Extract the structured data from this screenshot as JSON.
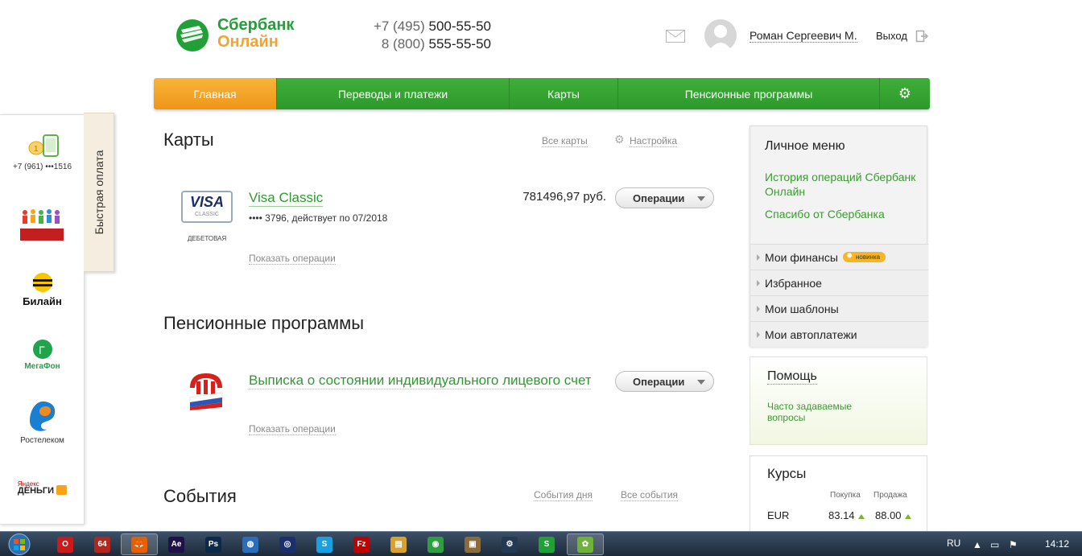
{
  "header": {
    "logo_line1": "Сбербанк",
    "logo_line2": "Онлайн",
    "phone1_prefix": "+7 (495)",
    "phone1_number": "500-55-50",
    "phone2_prefix": "8 (800)",
    "phone2_number": "555-55-50",
    "user_name": "Роман Сергеевич М.",
    "logout_label": "Выход"
  },
  "nav": {
    "items": [
      {
        "label": "Главная",
        "active": true
      },
      {
        "label": "Переводы и платежи"
      },
      {
        "label": "Карты"
      },
      {
        "label": "Пенсионные программы"
      }
    ],
    "settings_icon": "gear-icon"
  },
  "quick_pay": {
    "tab_label": "Быстрая оплата",
    "phone": "+7 (961) •••1516",
    "beeline": "Билайн",
    "megafon": "МегаФон",
    "rostelecom": "Ростелеком",
    "yandex_small": "Яндекс",
    "yandex_big": "ДЕНЬГИ"
  },
  "cards_section": {
    "title": "Карты",
    "all_cards": "Все карты",
    "settings": "Настройка",
    "card": {
      "logo_text": "VISA",
      "logo_sub": "CLASSIC",
      "type": "ДЕБЕТОВАЯ",
      "name": "Visa Classic",
      "details": "•••• 3796, действует по 07/2018",
      "amount": "781496,97 руб.",
      "ops_label": "Операции",
      "show_ops": "Показать операции"
    }
  },
  "pension_section": {
    "title": "Пенсионные программы",
    "item_name": "Выписка о состоянии индивидуального лицевого счета",
    "ops_label": "Операции",
    "show_ops": "Показать операции"
  },
  "events_section": {
    "title": "События",
    "day_events": "События дня",
    "all_events": "Все события"
  },
  "personal_menu": {
    "title": "Личное меню",
    "link1": "История операций Сбербанк Онлайн",
    "link2": "Спасибо от Сбербанка",
    "rows": [
      {
        "label": "Мои финансы",
        "badge": "новинка"
      },
      {
        "label": "Избранное"
      },
      {
        "label": "Мои шаблоны"
      },
      {
        "label": "Мои автоплатежи"
      }
    ]
  },
  "help": {
    "title": "Помощь",
    "faq": "Часто задаваемые вопросы"
  },
  "rates": {
    "title": "Курсы",
    "buy_label": "Покупка",
    "sell_label": "Продажа",
    "rows": [
      {
        "currency": "EUR",
        "buy": "83.14",
        "sell": "88.00"
      }
    ]
  },
  "taskbar": {
    "lang": "RU",
    "time": "14:12",
    "apps": [
      {
        "name": "opera",
        "color": "#cc1a1a",
        "glyph": "O"
      },
      {
        "name": "app-64",
        "color": "#b3261e",
        "glyph": "64"
      },
      {
        "name": "firefox",
        "color": "#e66000",
        "glyph": "🦊"
      },
      {
        "name": "after-effects",
        "color": "#1f1048",
        "glyph": "Ae"
      },
      {
        "name": "photoshop",
        "color": "#0b2a4a",
        "glyph": "Ps"
      },
      {
        "name": "globe",
        "color": "#2a6ebb",
        "glyph": "◍"
      },
      {
        "name": "cinema",
        "color": "#1b2f6a",
        "glyph": "◎"
      },
      {
        "name": "skype",
        "color": "#1aa0e0",
        "glyph": "S"
      },
      {
        "name": "filezilla",
        "color": "#bf0000",
        "glyph": "Fz"
      },
      {
        "name": "explorer",
        "color": "#d9a02b",
        "glyph": "▤"
      },
      {
        "name": "chrome",
        "color": "#2f9e41",
        "glyph": "◉"
      },
      {
        "name": "app-window",
        "color": "#8a6c3a",
        "glyph": "▣"
      },
      {
        "name": "steam",
        "color": "#233a55",
        "glyph": "⚙"
      },
      {
        "name": "sber",
        "color": "#21a038",
        "glyph": "S"
      },
      {
        "name": "icq",
        "color": "#6fb23a",
        "glyph": "✿"
      }
    ]
  }
}
